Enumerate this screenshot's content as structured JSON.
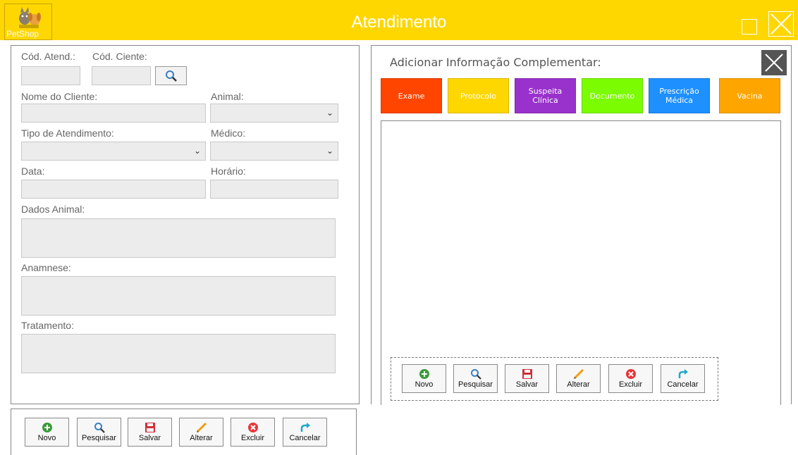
{
  "window": {
    "logo_text": "PetShop",
    "title": "Atendimento"
  },
  "form": {
    "cod_atend_label": "Cód. Atend.:",
    "cod_cliente_label": "Cód. Ciente:",
    "cod_atend_value": "",
    "cod_cliente_value": "",
    "nome_cliente_label": "Nome do Cliente:",
    "nome_cliente_value": "",
    "animal_label": "Animal:",
    "animal_value": "",
    "tipo_atendimento_label": "Tipo de Atendimento:",
    "tipo_atendimento_value": "",
    "medico_label": "Médico:",
    "medico_value": "",
    "data_label": "Data:",
    "data_value": "",
    "horario_label": "Horário:",
    "horario_value": "",
    "dados_animal_label": "Dados Animal:",
    "dados_animal_value": "",
    "anamnese_label": "Anamnese:",
    "anamnese_value": "",
    "tratamento_label": "Tratamento:",
    "tratamento_value": ""
  },
  "toolbar": {
    "novo": "Novo",
    "pesquisar": "Pesquisar",
    "salvar": "Salvar",
    "alterar": "Alterar",
    "excluir": "Excluir",
    "cancelar": "Cancelar"
  },
  "complementar": {
    "title": "Adicionar Informação Complementar:",
    "categories": [
      {
        "label": "Exame",
        "color": "#ff4500"
      },
      {
        "label": "Protocolo",
        "color": "#ffd700"
      },
      {
        "label": "Suspeita Clínica",
        "color": "#9932cc"
      },
      {
        "label": "Documento",
        "color": "#7cfc00"
      },
      {
        "label": "Prescrição Médica",
        "color": "#1e90ff"
      },
      {
        "label": "Vacina",
        "color": "#ffa500"
      }
    ]
  },
  "colors": {
    "titlebar": "#ffd700",
    "novo_icon": "#3a9a3a",
    "pesquisar_icon": "#3a7fc2",
    "salvar_icon": "#d0303a",
    "alterar_icon": "#f39c12",
    "excluir_icon": "#e8353a",
    "cancelar_icon": "#1fa8c9"
  },
  "icons": {
    "logo": "cat-dog-logo-icon",
    "search": "magnifier-icon",
    "novo": "plus-circle-icon",
    "salvar": "floppy-disk-icon",
    "alterar": "pencil-icon",
    "excluir": "x-circle-icon",
    "cancelar": "redo-arrow-icon"
  }
}
